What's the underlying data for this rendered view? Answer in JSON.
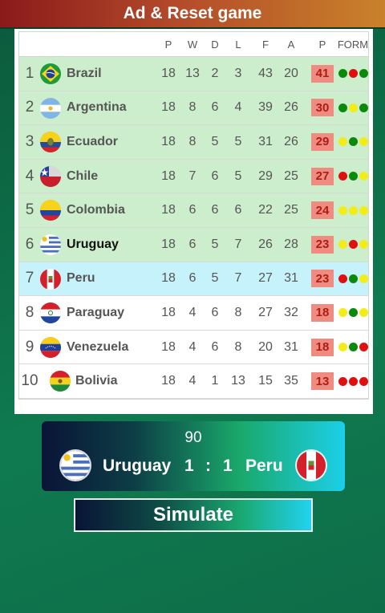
{
  "topbar": {
    "label": "Ad & Reset game"
  },
  "table": {
    "headers": [
      "P",
      "W",
      "D",
      "L",
      "F",
      "A",
      "P",
      "FORM"
    ],
    "rows": [
      {
        "pos": "1",
        "team": "Brazil",
        "flag": "brazil-flag",
        "p": "18",
        "w": "13",
        "d": "2",
        "l": "3",
        "f": "43",
        "a": "20",
        "pts": "41",
        "zone": "qualify",
        "form": [
          "#0a8a0a",
          "#e01010",
          "#0a8a0a"
        ]
      },
      {
        "pos": "2",
        "team": "Argentina",
        "flag": "argentina-flag",
        "p": "18",
        "w": "8",
        "d": "6",
        "l": "4",
        "f": "39",
        "a": "26",
        "pts": "30",
        "zone": "qualify",
        "form": [
          "#0a8a0a",
          "#f2ec18",
          "#0a8a0a"
        ]
      },
      {
        "pos": "3",
        "team": "Ecuador",
        "flag": "ecuador-flag",
        "p": "18",
        "w": "8",
        "d": "5",
        "l": "5",
        "f": "31",
        "a": "26",
        "pts": "29",
        "zone": "qualify",
        "form": [
          "#f2ec18",
          "#0a8a0a",
          "#f2ec18"
        ]
      },
      {
        "pos": "4",
        "team": "Chile",
        "flag": "chile-flag",
        "p": "18",
        "w": "7",
        "d": "6",
        "l": "5",
        "f": "29",
        "a": "25",
        "pts": "27",
        "zone": "qualify",
        "form": [
          "#e01010",
          "#0a8a0a",
          "#f2ec18"
        ]
      },
      {
        "pos": "5",
        "team": "Colombia",
        "flag": "colombia-flag",
        "p": "18",
        "w": "6",
        "d": "6",
        "l": "6",
        "f": "22",
        "a": "25",
        "pts": "24",
        "zone": "qualify",
        "form": [
          "#f2ec18",
          "#f2ec18",
          "#f2ec18"
        ]
      },
      {
        "pos": "6",
        "team": "Uruguay",
        "flag": "uruguay-flag",
        "p": "18",
        "w": "6",
        "d": "5",
        "l": "7",
        "f": "26",
        "a": "28",
        "pts": "23",
        "zone": "qualify",
        "highlight": true,
        "form": [
          "#f2ec18",
          "#e01010",
          "#f2ec18"
        ]
      },
      {
        "pos": "7",
        "team": "Peru",
        "flag": "peru-flag",
        "p": "18",
        "w": "6",
        "d": "5",
        "l": "7",
        "f": "27",
        "a": "31",
        "pts": "23",
        "zone": "playoff",
        "form": [
          "#e01010",
          "#0a8a0a",
          "#f2ec18"
        ]
      },
      {
        "pos": "8",
        "team": "Paraguay",
        "flag": "paraguay-flag",
        "p": "18",
        "w": "4",
        "d": "6",
        "l": "8",
        "f": "27",
        "a": "32",
        "pts": "18",
        "zone": "none",
        "form": [
          "#f2ec18",
          "#0a8a0a",
          "#f2ec18"
        ]
      },
      {
        "pos": "9",
        "team": "Venezuela",
        "flag": "venezuela-flag",
        "p": "18",
        "w": "4",
        "d": "6",
        "l": "8",
        "f": "20",
        "a": "31",
        "pts": "18",
        "zone": "none",
        "form": [
          "#f2ec18",
          "#0a8a0a",
          "#e01010"
        ]
      },
      {
        "pos": "10",
        "team": "Bolivia",
        "flag": "bolivia-flag",
        "p": "18",
        "w": "4",
        "d": "1",
        "l": "13",
        "f": "15",
        "a": "35",
        "pts": "13",
        "zone": "none",
        "form": [
          "#e01010",
          "#e01010",
          "#e01010"
        ]
      }
    ]
  },
  "match": {
    "minute": "90",
    "home_team": "Uruguay",
    "home_flag": "uruguay-flag",
    "home_score": "1",
    "separator": ":",
    "away_score": "1",
    "away_team": "Peru",
    "away_flag": "peru-flag"
  },
  "simulate": {
    "label": "Simulate"
  },
  "colors": {
    "qualify_row": "#cdeecc",
    "playoff_row": "#c6f3fb",
    "points_bg": "#ef8c82",
    "points_text": "#b01c14",
    "form_win": "#0a8a0a",
    "form_draw": "#f2ec18",
    "form_loss": "#e01010"
  }
}
